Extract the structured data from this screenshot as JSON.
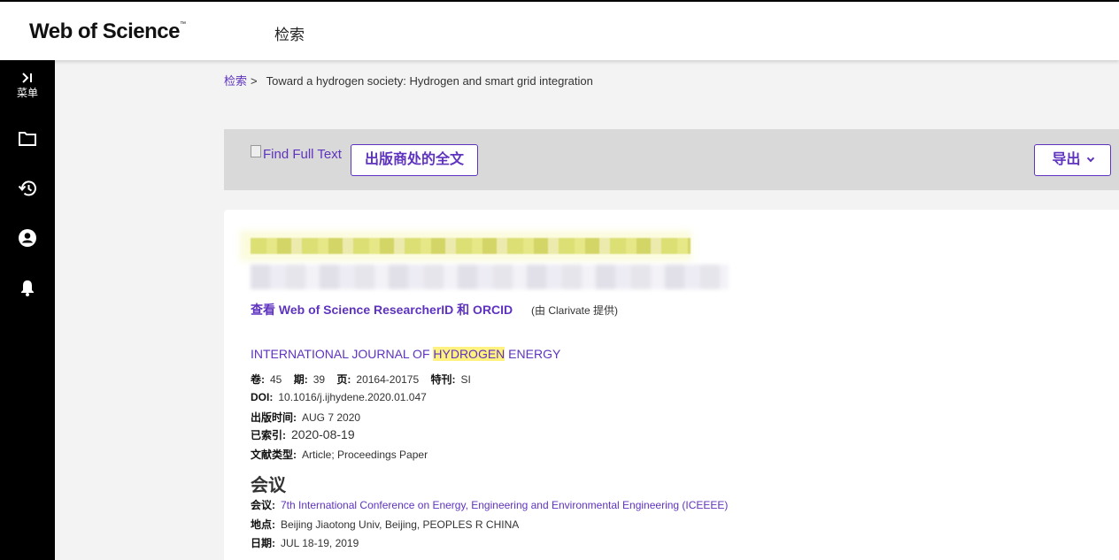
{
  "header": {
    "logo": "Web of Science",
    "logo_tm": "™",
    "nav_search": "检索"
  },
  "sidebar": {
    "menu_label": "菜单",
    "icons": [
      "expand-icon",
      "folder-icon",
      "history-icon",
      "account-icon",
      "bell-icon"
    ]
  },
  "breadcrumb": {
    "root": "检索",
    "separator": ">",
    "current": "Toward a hydrogen society: Hydrogen and smart grid integration"
  },
  "toolbar": {
    "find_full_text": "Find Full Text",
    "publisher_button": "出版商处的全文",
    "export_button": "导出"
  },
  "record": {
    "researcher_link": "查看 Web of Science ResearcherID 和 ORCID",
    "provided_by": "(由 Clarivate 提供)",
    "journal_prefix": "INTERNATIONAL JOURNAL OF ",
    "journal_highlight": "HYDROGEN",
    "journal_suffix": " ENERGY",
    "volume_label": "卷:",
    "volume": "45",
    "issue_label": "期:",
    "issue": "39",
    "pages_label": "页:",
    "pages": "20164-20175",
    "special_label": "特刊:",
    "special": "SI",
    "doi_label": "DOI:",
    "doi": "10.1016/j.ijhydene.2020.01.047",
    "published_label": "出版时间:",
    "published": "AUG 7 2020",
    "indexed_label": "已索引:",
    "indexed": "2020-08-19",
    "doctype_label": "文献类型:",
    "doctype": "Article; Proceedings Paper"
  },
  "conference": {
    "heading": "会议",
    "meeting_label": "会议:",
    "meeting": "7th International Conference on Energy, Engineering and Environmental Engineering (ICEEEE)",
    "location_label": "地点:",
    "location": "Beijing Jiaotong Univ, Beijing, PEOPLES R CHINA",
    "date_label": "日期:",
    "date": "JUL 18-19, 2019"
  },
  "colors": {
    "accent": "#5e33bf",
    "highlight": "#fff280",
    "sidebar": "#000000",
    "toolbar": "#d9d9d9"
  }
}
